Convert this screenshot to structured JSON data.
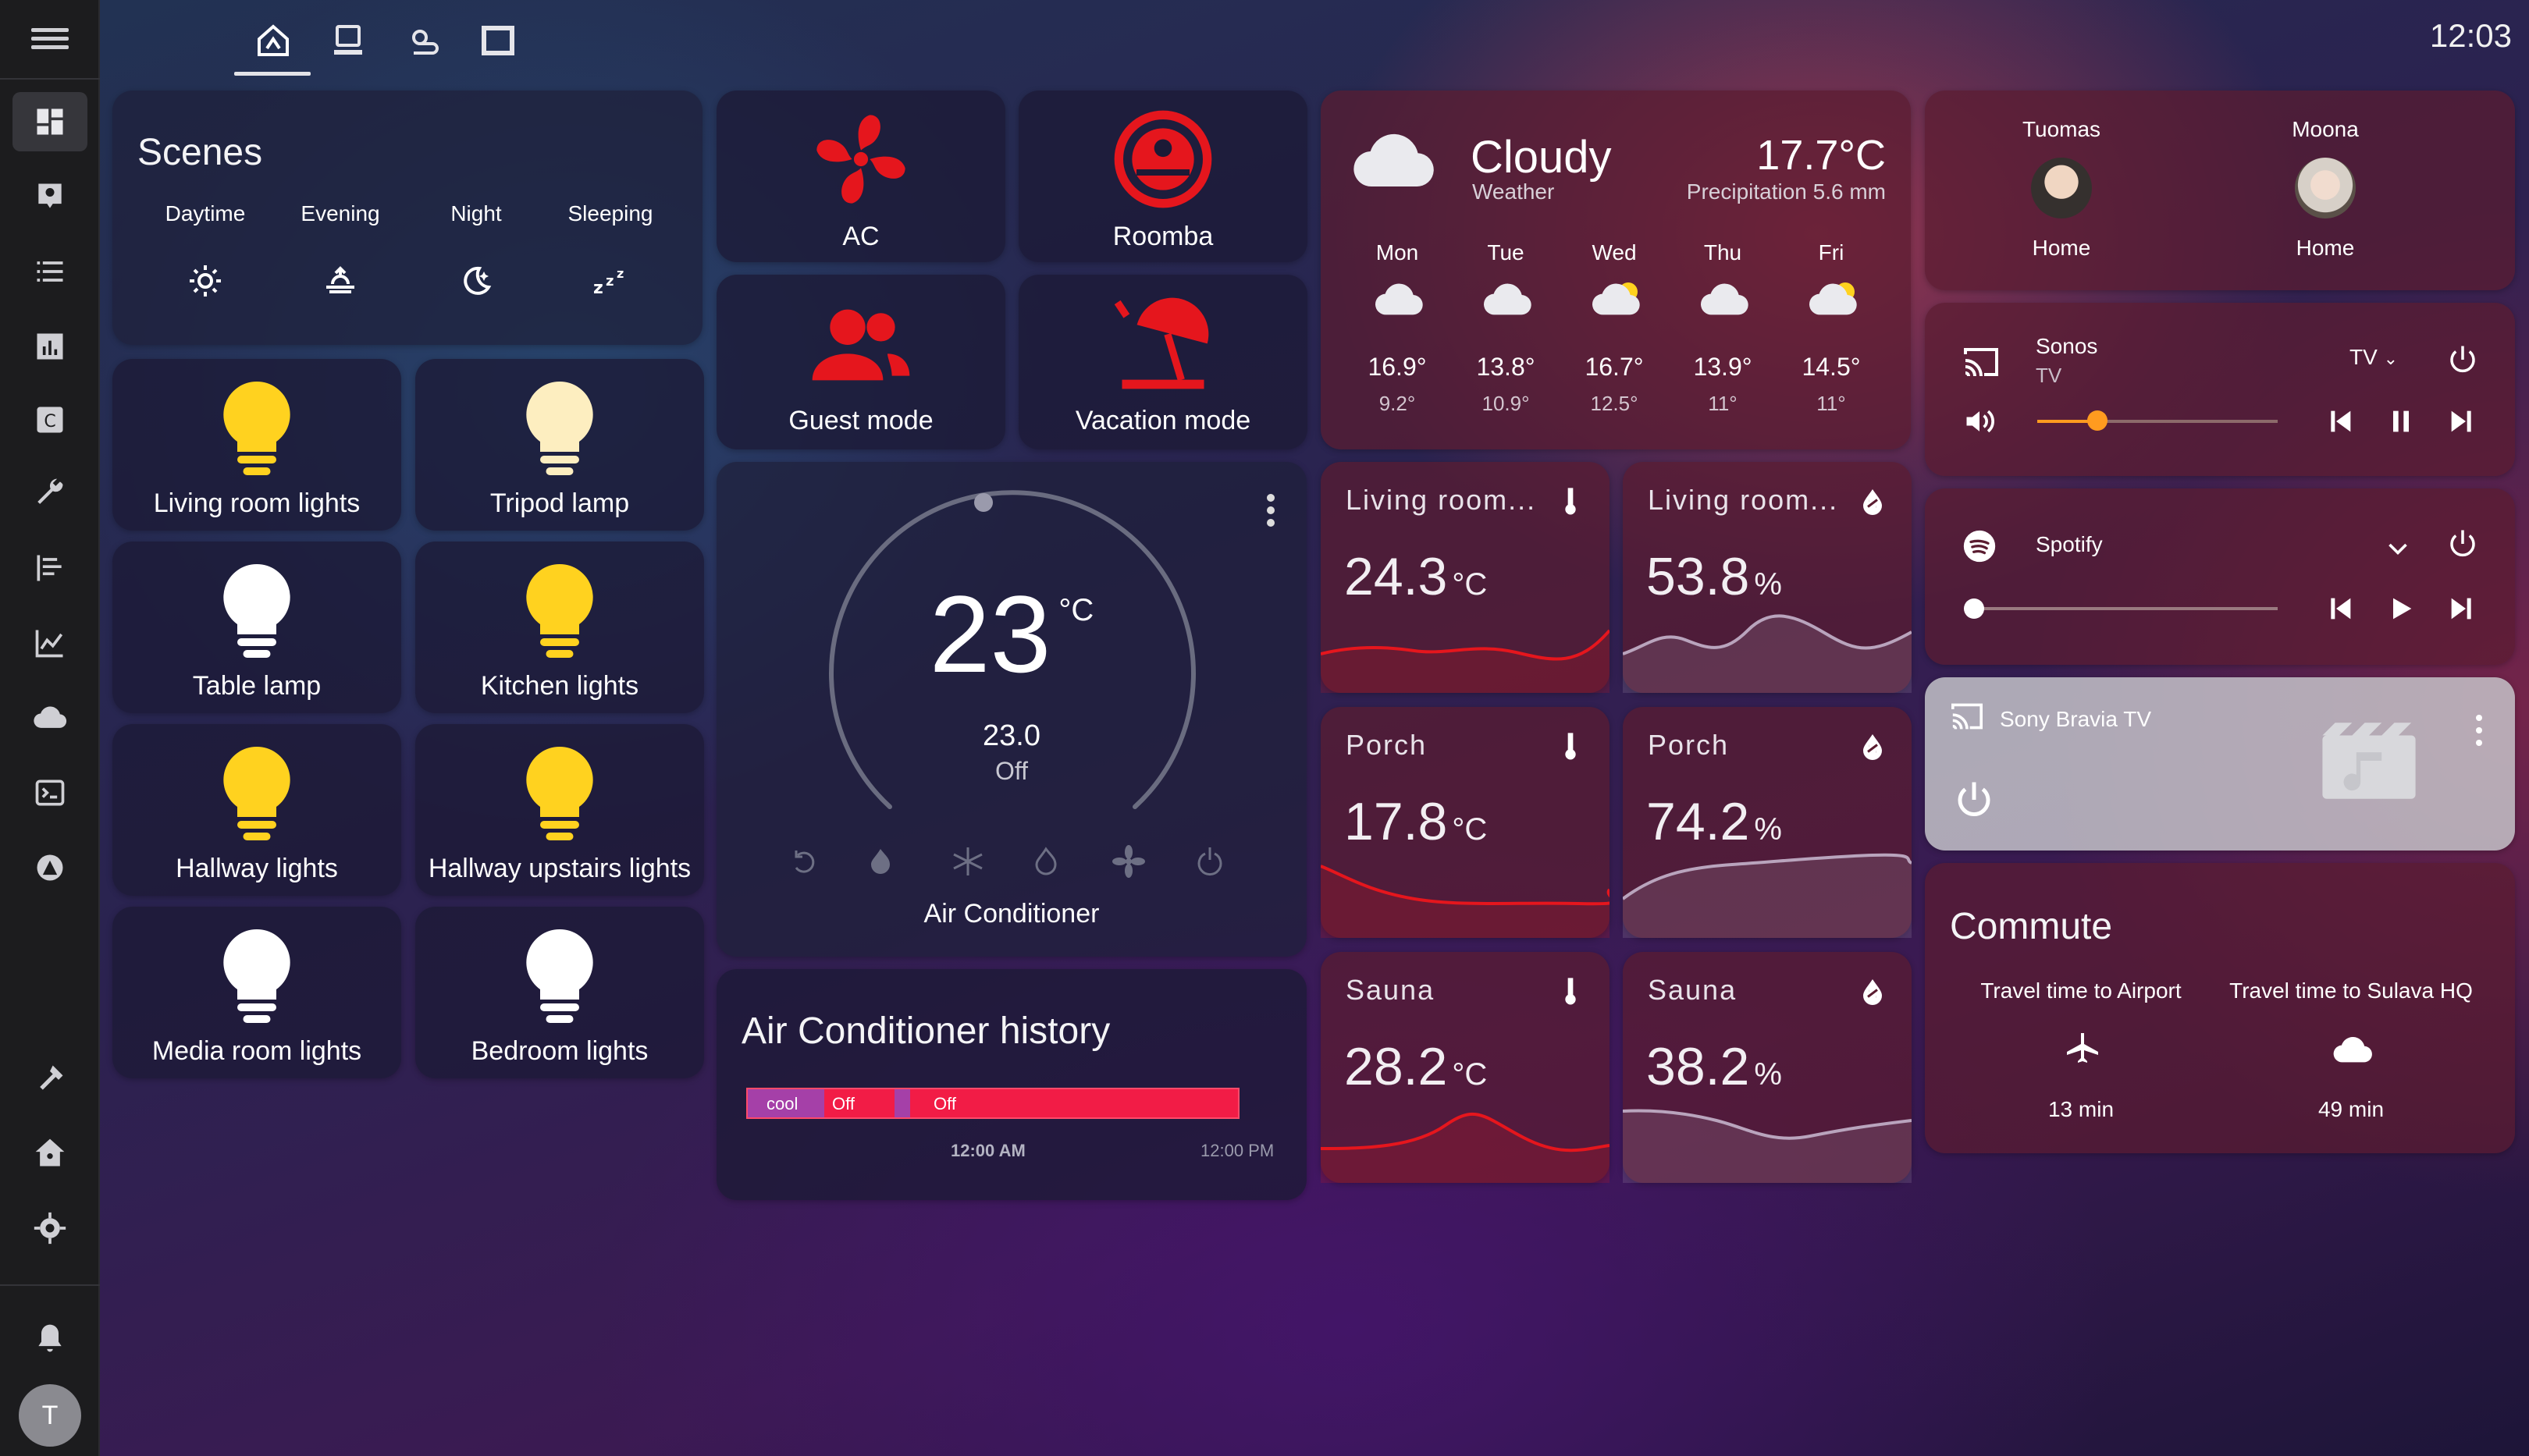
{
  "topbar": {
    "clock": "12:03"
  },
  "scenes": {
    "title": "Scenes",
    "items": [
      {
        "label": "Daytime",
        "icon": "sun-icon"
      },
      {
        "label": "Evening",
        "icon": "sunset-icon"
      },
      {
        "label": "Night",
        "icon": "moon-star-icon"
      },
      {
        "label": "Sleeping",
        "icon": "zzz-icon"
      }
    ]
  },
  "lights": [
    {
      "label": "Living room lights",
      "state": "on"
    },
    {
      "label": "Tripod lamp",
      "state": "dim"
    },
    {
      "label": "Table lamp",
      "state": "off"
    },
    {
      "label": "Kitchen lights",
      "state": "on"
    },
    {
      "label": "Hallway lights",
      "state": "on"
    },
    {
      "label": "Hallway upstairs lights",
      "state": "on"
    },
    {
      "label": "Media room lights",
      "state": "off"
    },
    {
      "label": "Bedroom lights",
      "state": "off"
    }
  ],
  "devices": [
    {
      "label": "AC",
      "icon": "fan-icon"
    },
    {
      "label": "Roomba",
      "icon": "robot-vacuum-icon"
    },
    {
      "label": "Guest mode",
      "icon": "guests-icon"
    },
    {
      "label": "Vacation mode",
      "icon": "beach-umbrella-icon"
    }
  ],
  "thermostat": {
    "target": "23",
    "unit": "°C",
    "current": "23.0",
    "mode": "Off",
    "name": "Air Conditioner"
  },
  "history": {
    "title": "Air Conditioner history",
    "seg1": "cool",
    "seg2": "Off",
    "seg3": "Off",
    "t1": "12:00 AM",
    "t2": "12:00 PM"
  },
  "weather": {
    "condition": "Cloudy",
    "subtitle": "Weather",
    "temp": "17.7°C",
    "precip": "Precipitation 5.6 mm",
    "forecast": [
      {
        "day": "Mon",
        "high": "16.9°",
        "low": "9.2°"
      },
      {
        "day": "Tue",
        "high": "13.8°",
        "low": "10.9°"
      },
      {
        "day": "Wed",
        "high": "16.7°",
        "low": "12.5°"
      },
      {
        "day": "Thu",
        "high": "13.9°",
        "low": "11°"
      },
      {
        "day": "Fri",
        "high": "14.5°",
        "low": "11°"
      }
    ]
  },
  "sensors": [
    {
      "name": "Living room...",
      "value": "24.3",
      "unit": "°C",
      "kind": "temp"
    },
    {
      "name": "Living room...",
      "value": "53.8",
      "unit": "%",
      "kind": "humidity"
    },
    {
      "name": "Porch",
      "value": "17.8",
      "unit": "°C",
      "kind": "temp"
    },
    {
      "name": "Porch",
      "value": "74.2",
      "unit": "%",
      "kind": "humidity"
    },
    {
      "name": "Sauna",
      "value": "28.2",
      "unit": "°C",
      "kind": "temp"
    },
    {
      "name": "Sauna",
      "value": "38.2",
      "unit": "%",
      "kind": "humidity"
    }
  ],
  "persons": [
    {
      "name": "Tuomas",
      "state": "Home"
    },
    {
      "name": "Moona",
      "state": "Home"
    }
  ],
  "sonos": {
    "name": "Sonos",
    "source": "TV",
    "select": "TV",
    "volume": 0.25
  },
  "spotify": {
    "name": "Spotify",
    "progress": 0.0
  },
  "tv": {
    "name": "Sony Bravia TV"
  },
  "commute": {
    "title": "Commute",
    "routes": [
      {
        "label": "Travel time to Airport",
        "value": "13 min",
        "icon": "airplane-icon"
      },
      {
        "label": "Travel time to Sulava HQ",
        "value": "49 min",
        "icon": "cloud-icon"
      }
    ]
  },
  "colors": {
    "accent": "#ff9b1f",
    "red": "#e5161d",
    "yellow": "#ffd21f"
  }
}
